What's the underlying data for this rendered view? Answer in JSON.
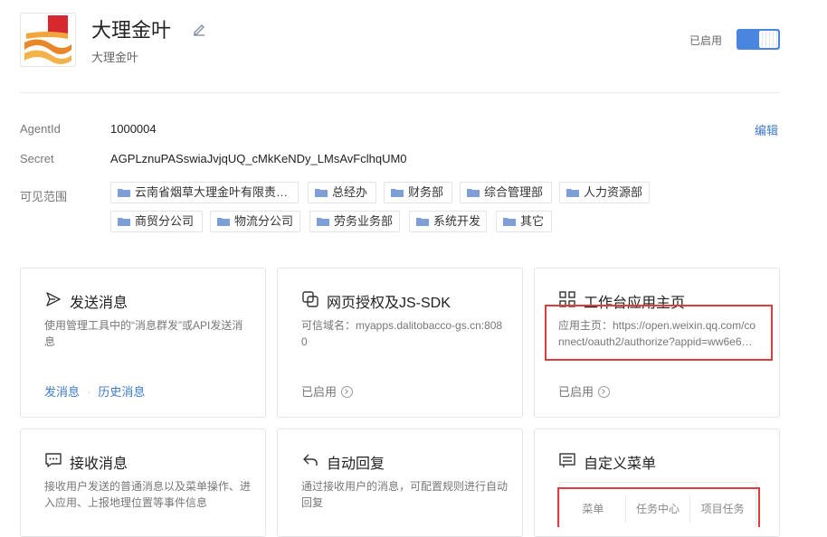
{
  "app": {
    "name": "大理金叶",
    "subtitle": "大理金叶",
    "status_label": "已启用"
  },
  "info": {
    "agentid_label": "AgentId",
    "agentid_value": "1000004",
    "secret_label": "Secret",
    "secret_value": "AGPLznuPASswiaJvjqUQ_cMkKeNDy_LMsAvFclhqUM0",
    "scope_label": "可见范围",
    "edit_label": "编辑"
  },
  "scope_tags": [
    "云南省烟草大理金叶有限责…",
    "总经办",
    "财务部",
    "综合管理部",
    "人力资源部",
    "商贸分公司",
    "物流分公司",
    "劳务业务部",
    "系统开发",
    "其它"
  ],
  "cards": {
    "send": {
      "title": "发送消息",
      "desc": "使用管理工具中的“消息群发”或API发送消息",
      "link1": "发消息",
      "sep": "·",
      "link2": "历史消息"
    },
    "auth": {
      "title": "网页授权及JS-SDK",
      "desc": "可信域名：myapps.dalitobacco-gs.cn:8080",
      "status": "已启用"
    },
    "workbench": {
      "title": "工作台应用主页",
      "desc": "应用主页：https://open.weixin.qq.com/connect/oauth2/authorize?appid=ww6e6…",
      "status": "已启用"
    },
    "receive": {
      "title": "接收消息",
      "desc": "接收用户发送的普通消息以及菜单操作、进入应用、上报地理位置等事件信息"
    },
    "autoreply": {
      "title": "自动回复",
      "desc": "通过接收用户的消息，可配置规则进行自动回复"
    },
    "menu": {
      "title": "自定义菜单",
      "items": [
        "菜单",
        "任务中心",
        "项目任务"
      ]
    }
  },
  "colors": {
    "accent": "#3e7bc8",
    "toggle": "#4a86e0",
    "highlight": "#e23b3b"
  }
}
